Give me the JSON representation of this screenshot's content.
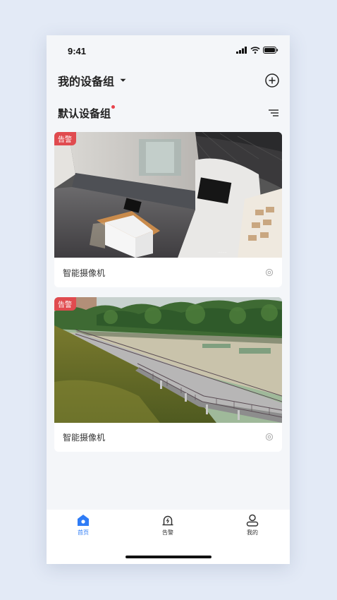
{
  "status_bar": {
    "time": "9:41"
  },
  "header": {
    "title": "我的设备组"
  },
  "group": {
    "name": "默认设备组"
  },
  "devices": [
    {
      "name": "智能摄像机",
      "badge": "告警"
    },
    {
      "name": "智能摄像机",
      "badge": "告警"
    }
  ],
  "tabs": [
    {
      "label": "首页",
      "icon": "home-icon",
      "active": true
    },
    {
      "label": "告警",
      "icon": "alarm-icon",
      "active": false
    },
    {
      "label": "我的",
      "icon": "user-icon",
      "active": false
    }
  ],
  "colors": {
    "accent": "#2f7cf6",
    "badge": "#e04b4f",
    "background": "#e3eaf6"
  }
}
